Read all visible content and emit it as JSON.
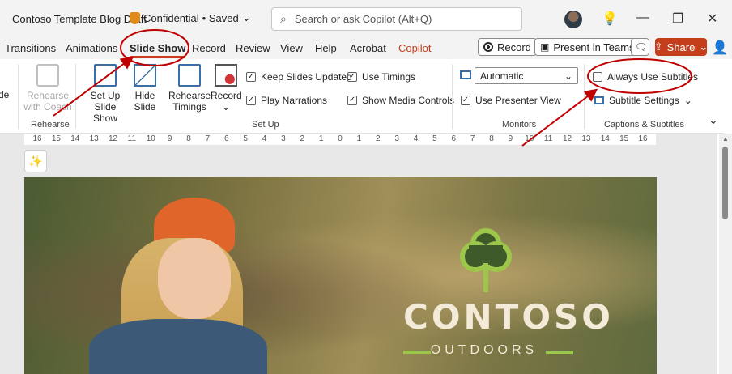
{
  "titlebar": {
    "doc_title": "Contoso Template Blog Draft",
    "sensitivity": "Confidential",
    "save_status": "• Saved",
    "search_placeholder": "Search or ask Copilot (Alt+Q)"
  },
  "tabs": [
    "Transitions",
    "Animations",
    "Slide Show",
    "Record",
    "Review",
    "View",
    "Help",
    "Acrobat",
    "Copilot"
  ],
  "active_tab": "Slide Show",
  "actions": {
    "record": "Record",
    "present_in_teams": "Present in Teams",
    "share": "Share"
  },
  "ribbon": {
    "cut_label": "de",
    "rehearse_with_coach": [
      "Rehearse",
      "with Coach"
    ],
    "setup_slideshow": [
      "Set Up",
      "Slide Show"
    ],
    "hide_slide": [
      "Hide",
      "Slide"
    ],
    "rehearse_timings": [
      "Rehearse",
      "Timings"
    ],
    "record": "Record",
    "keep_slides_updated": "Keep Slides Updated",
    "play_narrations": "Play Narrations",
    "use_timings": "Use Timings",
    "show_media_controls": "Show Media Controls",
    "monitor_value": "Automatic",
    "use_presenter_view": "Use Presenter View",
    "always_use_subtitles": "Always Use Subtitles",
    "subtitle_settings": "Subtitle Settings",
    "groups": {
      "rehearse": "Rehearse",
      "setup": "Set Up",
      "monitors": "Monitors",
      "captions": "Captions & Subtitles"
    }
  },
  "ruler": [
    "16",
    "15",
    "14",
    "13",
    "12",
    "11",
    "10",
    "9",
    "8",
    "7",
    "6",
    "5",
    "4",
    "3",
    "2",
    "1",
    "0",
    "1",
    "2",
    "3",
    "4",
    "5",
    "6",
    "7",
    "8",
    "9",
    "10",
    "11",
    "12",
    "13",
    "14",
    "15",
    "16"
  ],
  "slide": {
    "brand": "CONTOSO",
    "sub": "OUTDOORS"
  },
  "colors": {
    "accent": "#c43e1c",
    "annotation": "#c00000",
    "logo_green": "#9cc74a"
  }
}
